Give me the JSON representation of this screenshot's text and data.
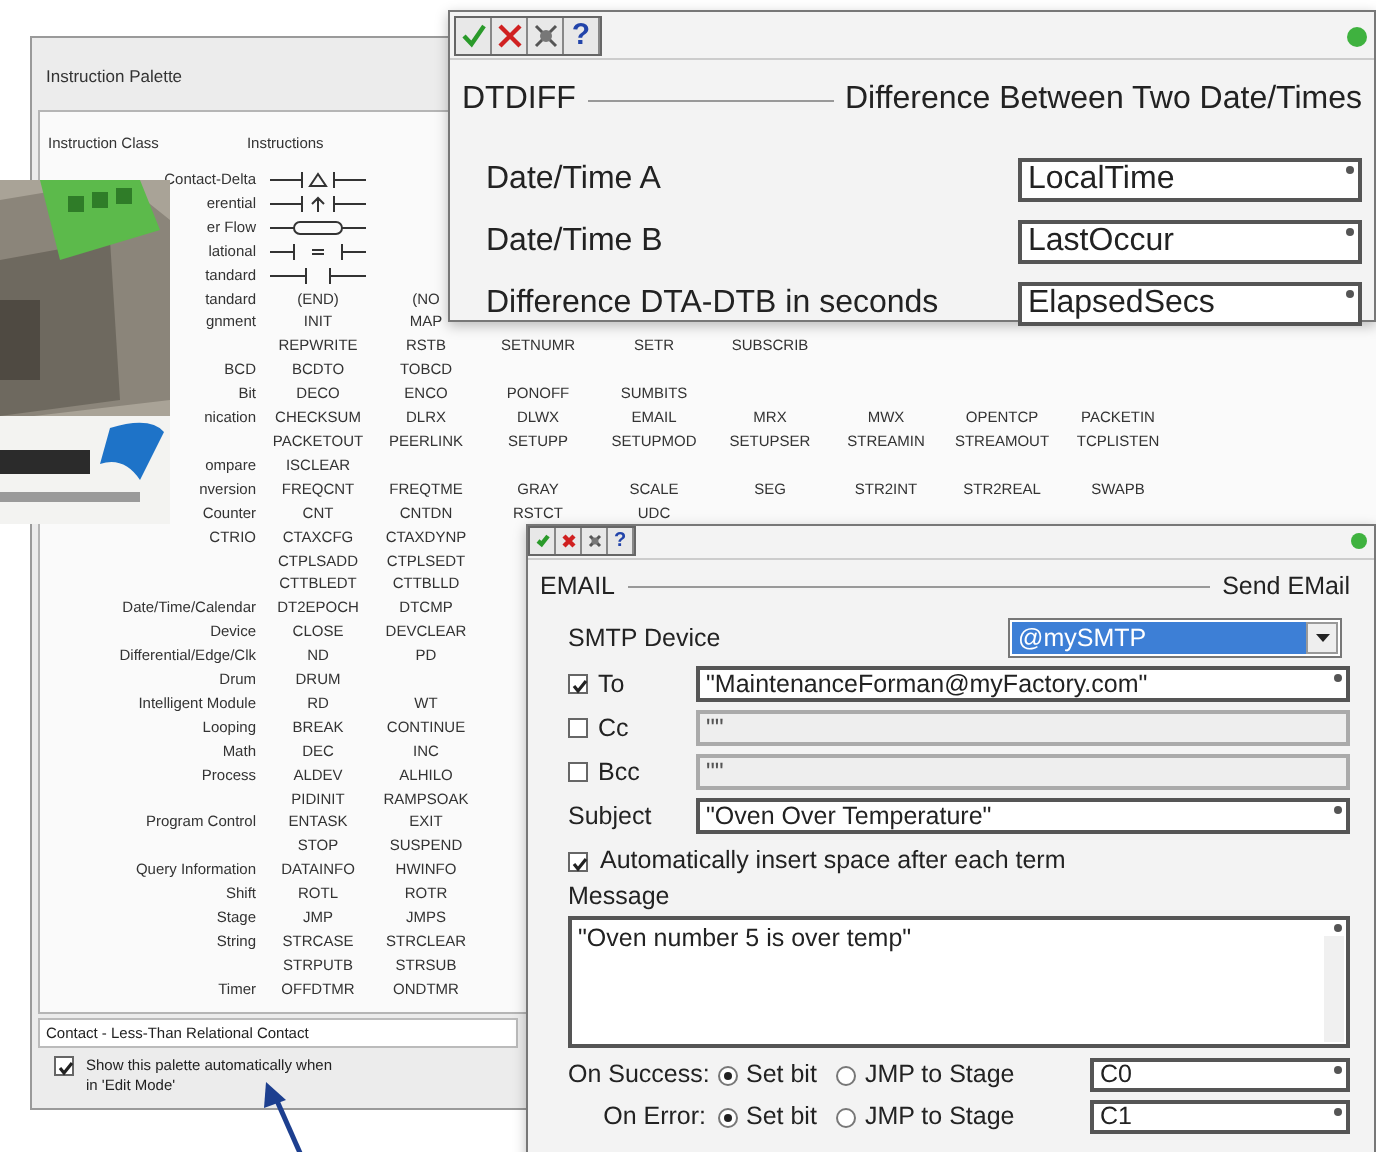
{
  "palette": {
    "title": "Instruction Palette",
    "columns": [
      "Instruction Class",
      "Instructions"
    ],
    "rows": [
      {
        "kind": "delta",
        "label": "Contact-Delta"
      },
      {
        "kind": "differential",
        "label": "erential"
      },
      {
        "kind": "powerflow",
        "label": "er Flow"
      },
      {
        "kind": "relational",
        "label": "lational"
      },
      {
        "kind": "standard",
        "label": "tandard"
      },
      {
        "kind": "text",
        "label": "tandard",
        "items": [
          "(END)",
          "(NO"
        ]
      },
      {
        "kind": "text",
        "label": "gnment",
        "items": [
          "INIT",
          "MAP"
        ]
      },
      {
        "kind": "text",
        "items": [
          "REPWRITE",
          "RSTB",
          "SETNUMR",
          "SETR",
          "SUBSCRIB"
        ]
      },
      {
        "kind": "text",
        "label": "BCD",
        "items": [
          "BCDTO",
          "TOBCD"
        ]
      },
      {
        "kind": "text",
        "label": "Bit",
        "items": [
          "DECO",
          "ENCO",
          "PONOFF",
          "SUMBITS"
        ]
      },
      {
        "kind": "text",
        "label": "nication",
        "items": [
          "CHECKSUM",
          "DLRX",
          "DLWX",
          "EMAIL",
          "MRX",
          "MWX",
          "OPENTCP",
          "PACKETIN"
        ]
      },
      {
        "kind": "text",
        "items": [
          "PACKETOUT",
          "PEERLINK",
          "SETUPP",
          "SETUPMOD",
          "SETUPSER",
          "STREAMIN",
          "STREAMOUT",
          "TCPLISTEN"
        ]
      },
      {
        "kind": "text",
        "label": "ompare",
        "items": [
          "ISCLEAR"
        ]
      },
      {
        "kind": "text",
        "label": "nversion",
        "items": [
          "FREQCNT",
          "FREQTME",
          "GRAY",
          "SCALE",
          "SEG",
          "STR2INT",
          "STR2REAL",
          "SWAPB"
        ]
      },
      {
        "kind": "text",
        "label": "Counter",
        "items": [
          "CNT",
          "CNTDN",
          "RSTCT",
          "UDC"
        ]
      },
      {
        "kind": "text",
        "label": "CTRIO",
        "items": [
          "CTAXCFG",
          "CTAXDYNP"
        ]
      },
      {
        "kind": "text",
        "items": [
          "CTPLSADD",
          "CTPLSEDT"
        ]
      },
      {
        "kind": "text",
        "items": [
          "CTTBLEDT",
          "CTTBLLD"
        ]
      },
      {
        "kind": "text",
        "label": "Date/Time/Calendar",
        "items": [
          "DT2EPOCH",
          "DTCMP"
        ]
      },
      {
        "kind": "text",
        "label": "Device",
        "items": [
          "CLOSE",
          "DEVCLEAR"
        ]
      },
      {
        "kind": "text",
        "label": "Differential/Edge/Clk",
        "items": [
          "ND",
          "PD"
        ]
      },
      {
        "kind": "text",
        "label": "Drum",
        "items": [
          "DRUM"
        ]
      },
      {
        "kind": "text",
        "label": "Intelligent Module",
        "items": [
          "RD",
          "WT"
        ]
      },
      {
        "kind": "text",
        "label": "Looping",
        "items": [
          "BREAK",
          "CONTINUE"
        ]
      },
      {
        "kind": "text",
        "label": "Math",
        "items": [
          "DEC",
          "INC"
        ]
      },
      {
        "kind": "text",
        "label": "Process",
        "items": [
          "ALDEV",
          "ALHILO"
        ]
      },
      {
        "kind": "text",
        "items": [
          "PIDINIT",
          "RAMPSOAK"
        ]
      },
      {
        "kind": "text",
        "label": "Program Control",
        "items": [
          "ENTASK",
          "EXIT"
        ]
      },
      {
        "kind": "text",
        "items": [
          "STOP",
          "SUSPEND"
        ]
      },
      {
        "kind": "text",
        "label": "Query Information",
        "items": [
          "DATAINFO",
          "HWINFO"
        ]
      },
      {
        "kind": "text",
        "label": "Shift",
        "items": [
          "ROTL",
          "ROTR"
        ]
      },
      {
        "kind": "text",
        "label": "Stage",
        "items": [
          "JMP",
          "JMPS"
        ]
      },
      {
        "kind": "text",
        "label": "String",
        "items": [
          "STRCASE",
          "STRCLEAR"
        ]
      },
      {
        "kind": "text",
        "items": [
          "STRPUTB",
          "STRSUB"
        ]
      },
      {
        "kind": "text",
        "label": "Timer",
        "items": [
          "OFFDTMR",
          "ONDTMR"
        ]
      }
    ],
    "status": "Contact - Less-Than Relational Contact",
    "auto_show": {
      "label": "Show this palette automatically when in 'Edit Mode'",
      "checked": true
    }
  },
  "dtdiff": {
    "toolbar": [
      {
        "kind": "ok"
      },
      {
        "kind": "cancel"
      },
      {
        "kind": "tools"
      },
      {
        "kind": "help",
        "label": "?"
      }
    ],
    "name": "DTDIFF",
    "description": "Difference Between Two Date/Times",
    "params": [
      {
        "label": "Date/Time A",
        "value": "LocalTime"
      },
      {
        "label": "Date/Time B",
        "value": "LastOccur"
      },
      {
        "label": "Difference DTA-DTB in seconds",
        "value": "ElapsedSecs"
      }
    ]
  },
  "email": {
    "toolbar": [
      {
        "kind": "ok"
      },
      {
        "kind": "cancel"
      },
      {
        "kind": "tools"
      },
      {
        "kind": "help",
        "label": "?"
      }
    ],
    "name": "EMAIL",
    "description": "Send EMail",
    "device": {
      "label": "SMTP Device",
      "value": "@mySMTP"
    },
    "recipients": [
      {
        "label": "To",
        "checked": true,
        "value": "\"MaintenanceForman@myFactory.com\""
      },
      {
        "label": "Cc",
        "checked": false,
        "value": "\"\""
      },
      {
        "label": "Bcc",
        "checked": false,
        "value": "\"\""
      }
    ],
    "subject": {
      "label": "Subject",
      "value": "\"Oven Over Temperature\""
    },
    "auto_space": {
      "label": "Automatically insert space after each term",
      "checked": true
    },
    "message": {
      "label": "Message",
      "value": "\"Oven number 5 is over temp\""
    },
    "outcomes": [
      {
        "label": "On Success:",
        "options": [
          {
            "label": "Set bit",
            "selected": true
          },
          {
            "label": "JMP to Stage",
            "selected": false
          }
        ],
        "value": "C0"
      },
      {
        "label": "On Error:",
        "options": [
          {
            "label": "Set bit",
            "selected": true
          },
          {
            "label": "JMP to Stage",
            "selected": false
          }
        ],
        "value": "C1"
      }
    ]
  }
}
